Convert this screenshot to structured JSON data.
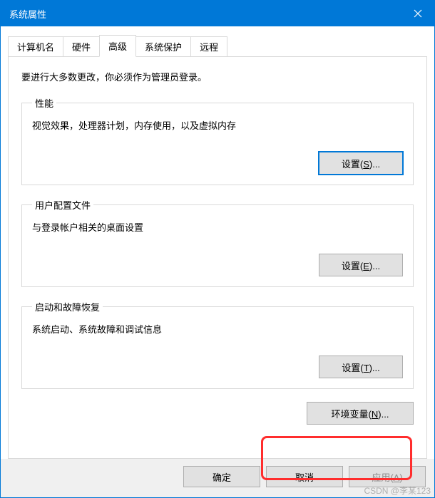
{
  "window": {
    "title": "系统属性"
  },
  "tabs": {
    "computer_name": "计算机名",
    "hardware": "硬件",
    "advanced": "高级",
    "system_protection": "系统保护",
    "remote": "远程"
  },
  "intro": "要进行大多数更改，你必须作为管理员登录。",
  "groups": {
    "performance": {
      "legend": "性能",
      "desc": "视觉效果，处理器计划，内存使用，以及虚拟内存",
      "button_prefix": "设置(",
      "button_hotkey": "S",
      "button_suffix": ")..."
    },
    "user_profiles": {
      "legend": "用户配置文件",
      "desc": "与登录帐户相关的桌面设置",
      "button_prefix": "设置(",
      "button_hotkey": "E",
      "button_suffix": ")..."
    },
    "startup_recovery": {
      "legend": "启动和故障恢复",
      "desc": "系统启动、系统故障和调试信息",
      "button_prefix": "设置(",
      "button_hotkey": "T",
      "button_suffix": ")..."
    }
  },
  "env_button": {
    "prefix": "环境变量(",
    "hotkey": "N",
    "suffix": ")..."
  },
  "footer": {
    "ok": "确定",
    "cancel": "取消",
    "apply_prefix": "应用(",
    "apply_hotkey": "A",
    "apply_suffix": ")"
  },
  "watermark": "CSDN @李某123"
}
